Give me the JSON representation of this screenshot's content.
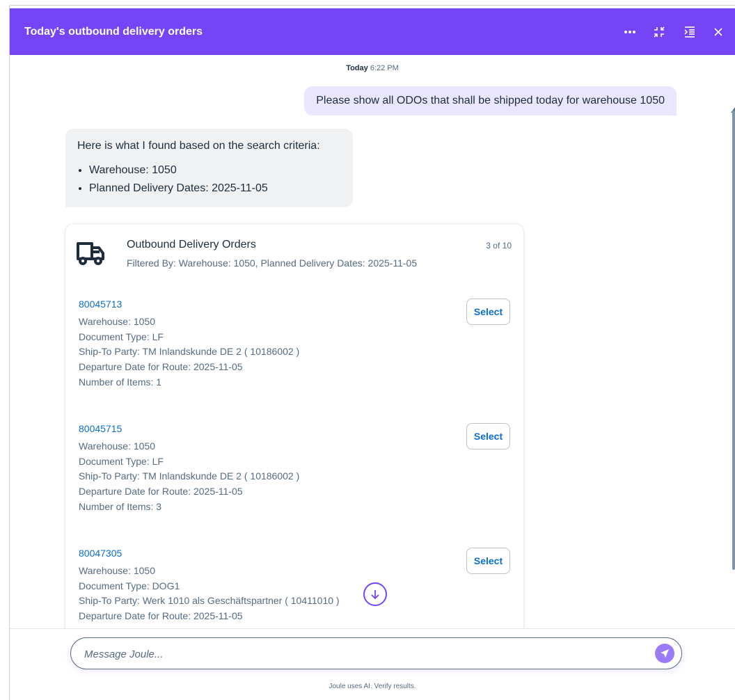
{
  "header": {
    "title": "Today's outbound delivery orders",
    "icons": [
      "more-icon",
      "exit-fullscreen-icon",
      "collapse-panel-icon",
      "close-icon"
    ]
  },
  "conversation": {
    "timestamp_day": "Today",
    "timestamp_time": "6:22 PM",
    "user_message": "Please show all ODOs that shall be shipped today for warehouse 1050",
    "bot_intro": "Here is what I found based on the search criteria:",
    "criteria": [
      "Warehouse: 1050",
      "Planned Delivery Dates: 2025-11-05"
    ]
  },
  "card": {
    "icon": "truck-icon",
    "title": "Outbound Delivery Orders",
    "subtitle": "Filtered By: Warehouse: 1050, Planned Delivery Dates: 2025-11-05",
    "count": "3 of 10",
    "select_label": "Select",
    "items": [
      {
        "id": "80045713",
        "warehouse": "Warehouse: 1050",
        "doc_type": "Document Type: LF",
        "ship_to": "Ship-To Party: TM Inlandskunde DE 2 ( 10186002 )",
        "departure": "Departure Date for Route: 2025-11-05",
        "num_items": "Number of Items: 1"
      },
      {
        "id": "80045715",
        "warehouse": "Warehouse: 1050",
        "doc_type": "Document Type: LF",
        "ship_to": "Ship-To Party: TM Inlandskunde DE 2 ( 10186002 )",
        "departure": "Departure Date for Route: 2025-11-05",
        "num_items": "Number of Items: 3"
      },
      {
        "id": "80047305",
        "warehouse": "Warehouse: 1050",
        "doc_type": "Document Type: DOG1",
        "ship_to": "Ship-To Party: Werk 1010 als Geschäftspartner ( 10411010 )",
        "departure": "Departure Date for Route: 2025-11-05",
        "num_items": ""
      }
    ]
  },
  "input": {
    "placeholder": "Message Joule...",
    "value": ""
  },
  "footer": {
    "disclaimer": "Joule uses AI. Verify results."
  },
  "colors": {
    "header_bg": "#7544f5",
    "user_bubble_bg": "#ebe6ff",
    "bot_bubble_bg": "#eff1f2",
    "link": "#0a6ed1",
    "send_button": "#9b7bf7"
  }
}
